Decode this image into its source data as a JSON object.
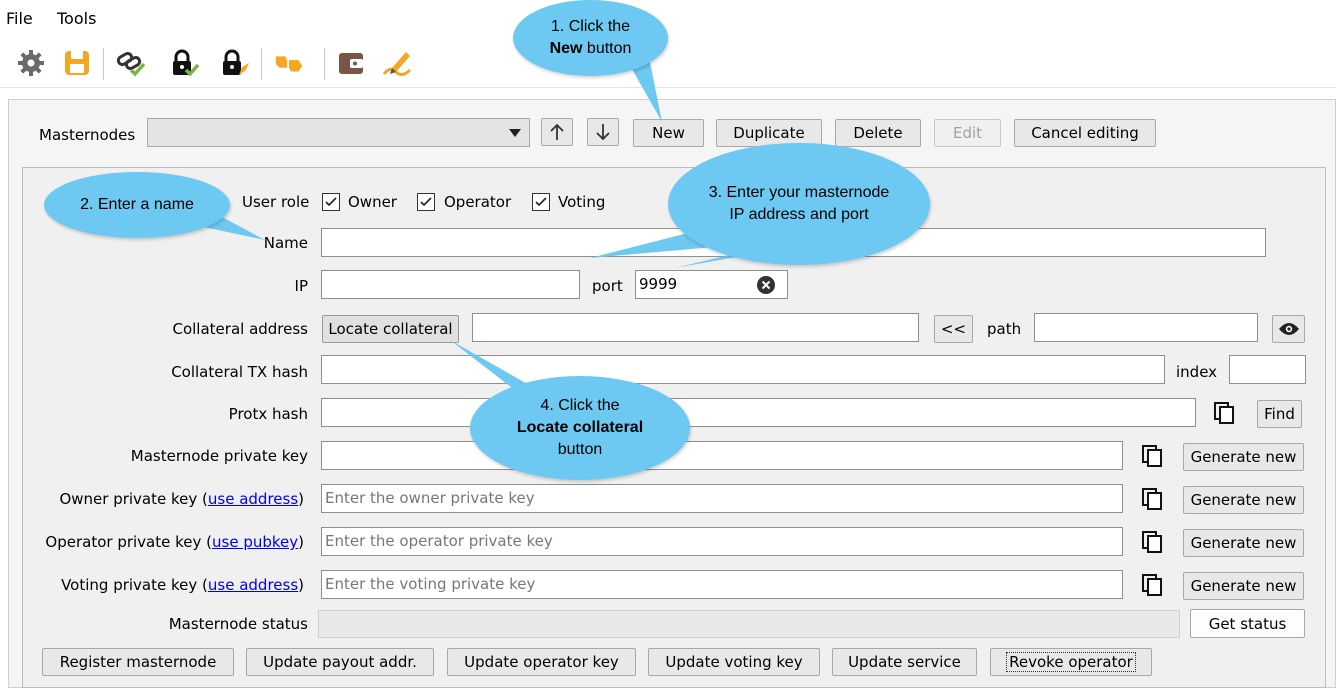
{
  "menu": {
    "file": "File",
    "tools": "Tools"
  },
  "toolbar": {
    "icons": [
      "gear-icon",
      "save-icon",
      "link-check-icon",
      "lock-check-icon",
      "lock-edit-icon",
      "hands-icon",
      "wallet-icon",
      "sign-icon"
    ],
    "accent": "#f5a623"
  },
  "masternodes": {
    "label": "Masternodes",
    "selected": "",
    "new": "New",
    "duplicate": "Duplicate",
    "delete": "Delete",
    "edit": "Edit",
    "cancel": "Cancel editing"
  },
  "roles": {
    "label": "User role",
    "owner": "Owner",
    "operator": "Operator",
    "voting": "Voting"
  },
  "fields": {
    "name": "Name",
    "ip": "IP",
    "port": "port",
    "port_value": "9999",
    "collateral_address": "Collateral address",
    "locate_collateral": "Locate collateral",
    "path_arrow": "<<",
    "path": "path",
    "collateral_tx": "Collateral TX hash",
    "index": "index",
    "protx": "Protx hash",
    "find": "Find",
    "mn_key": "Masternode private key",
    "owner_key_prefix": "Owner private key (",
    "owner_key_link": "use address",
    "owner_key_suffix": ")",
    "owner_placeholder": "Enter the owner private key",
    "operator_key_prefix": "Operator private key (",
    "operator_key_link": "use pubkey",
    "operator_key_suffix": ")",
    "operator_placeholder": "Enter the operator private key",
    "voting_key_prefix": "Voting private key (",
    "voting_key_link": "use address",
    "voting_key_suffix": ")",
    "voting_placeholder": "Enter the voting private key",
    "generate_new": "Generate new",
    "status": "Masternode status",
    "get_status": "Get status"
  },
  "actions": {
    "register": "Register masternode",
    "payout": "Update payout addr.",
    "operator_key": "Update operator key",
    "voting_key": "Update voting key",
    "service": "Update service",
    "revoke": "Revoke operator"
  },
  "bubbles": {
    "b1_line1": "1. Click the",
    "b1_bold": "New",
    "b1_rest": " button",
    "b2": "2. Enter a name",
    "b3_line1": "3. Enter your masternode",
    "b3_line2": "IP address and port",
    "b4_line1": "4. Click the",
    "b4_bold": "Locate collateral",
    "b4_line3": "button",
    "color": "#6dc9f2"
  }
}
